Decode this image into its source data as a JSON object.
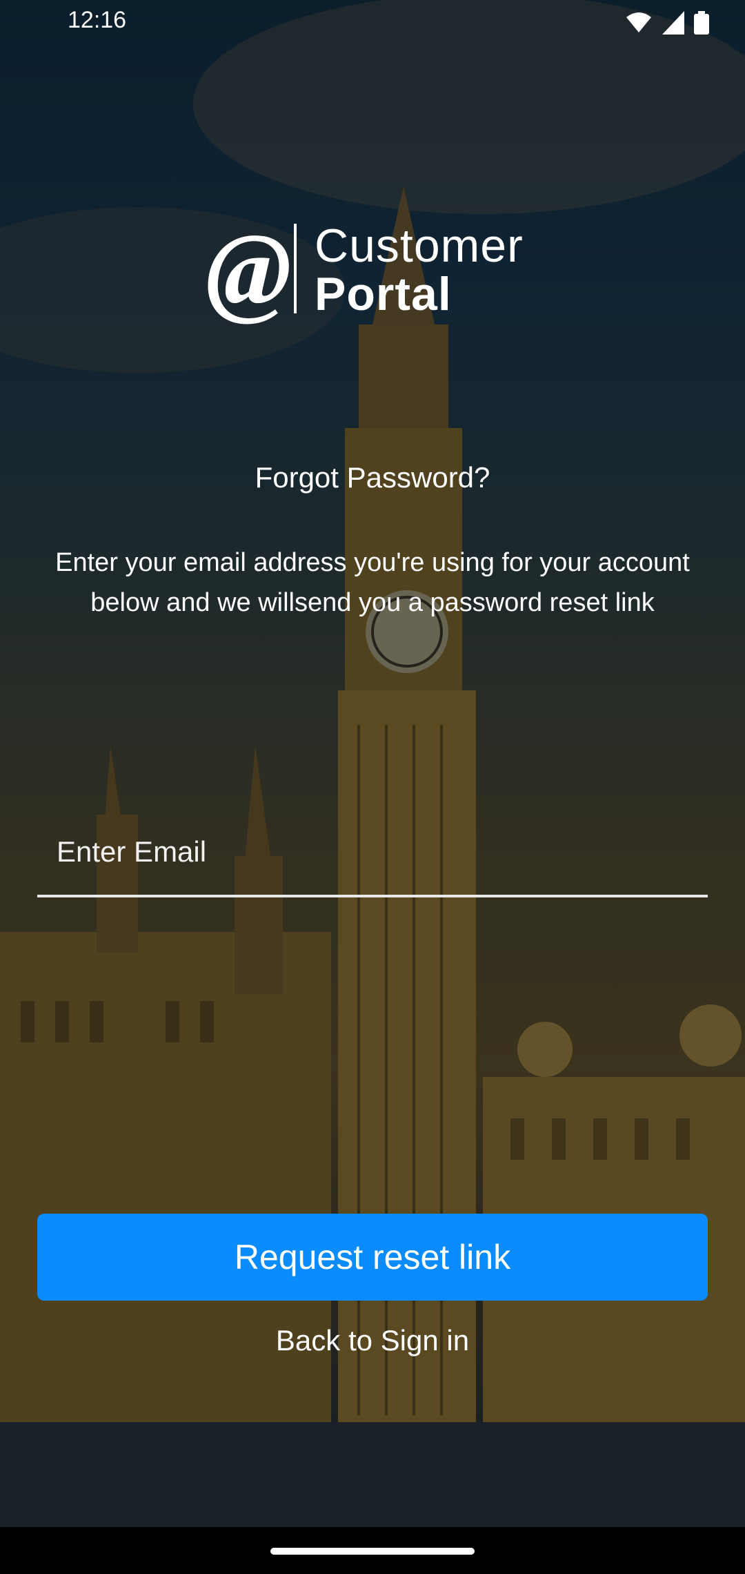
{
  "status_bar": {
    "time": "12:16",
    "icons": [
      "wifi-icon",
      "signal-icon",
      "battery-icon"
    ]
  },
  "logo": {
    "mark": "@",
    "line1": "Customer",
    "line2": "Portal"
  },
  "title": "Forgot Password?",
  "subtitle": "Enter your email address you're using for your account below and we willsend you a password reset link",
  "email": {
    "placeholder": "Enter Email",
    "value": ""
  },
  "reset_button_label": "Request reset link",
  "back_link_label": "Back to Sign in",
  "colors": {
    "primary_button": "#0a8cff",
    "text": "#ffffff"
  }
}
